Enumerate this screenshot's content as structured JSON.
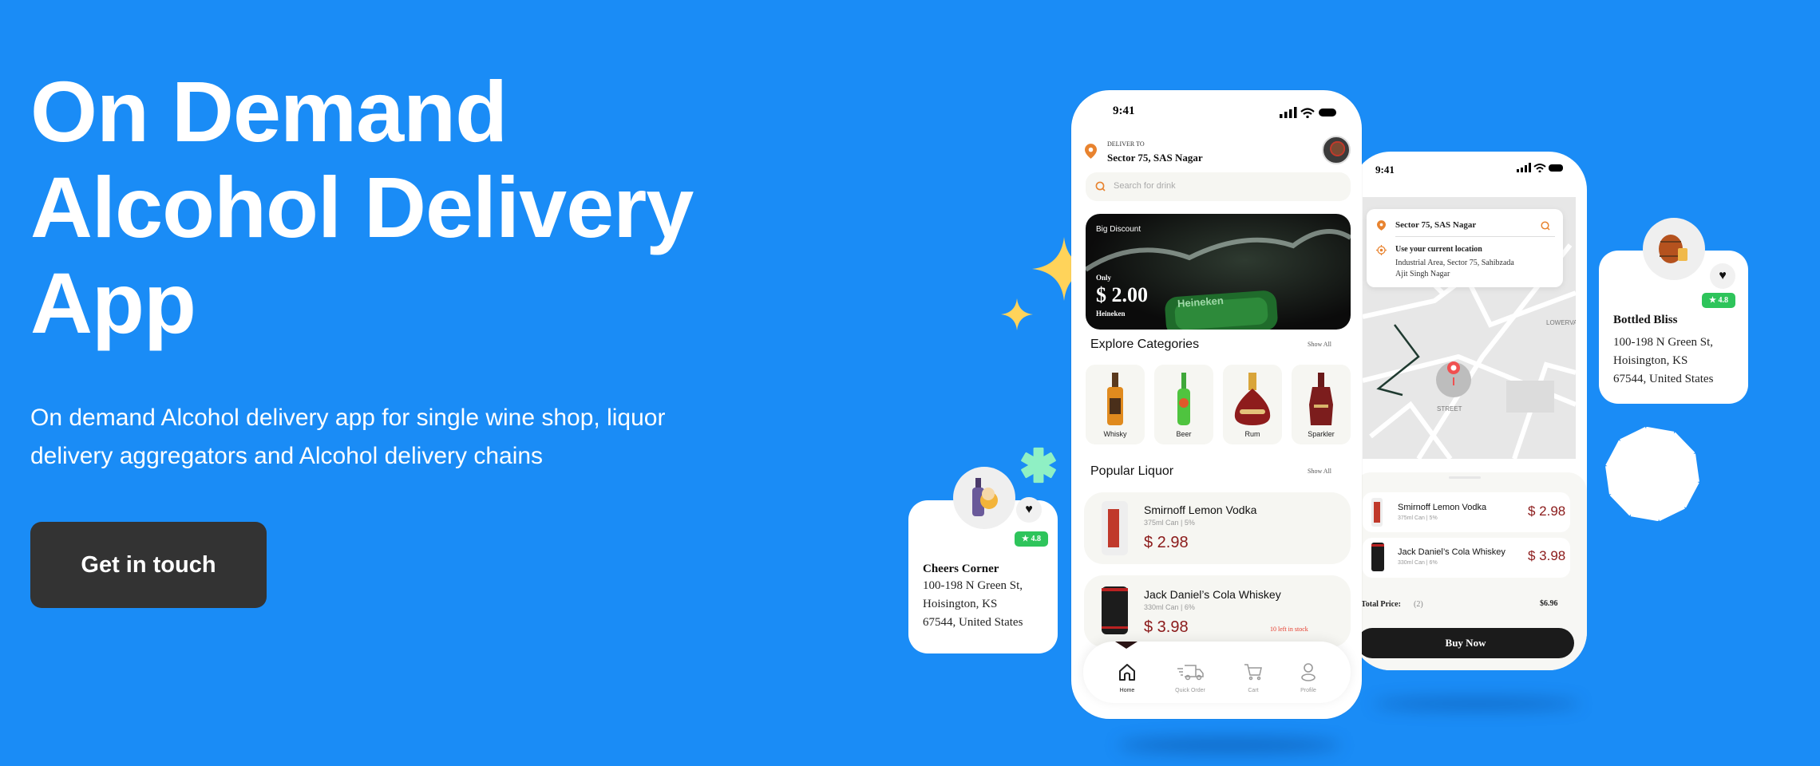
{
  "hero": {
    "title_lines": [
      "On Demand",
      "Alcohol Delivery",
      "App"
    ],
    "subtitle_lines": [
      "On demand Alcohol delivery app for single wine shop, liquor",
      "delivery aggregators and Alcohol delivery chains"
    ],
    "cta_label": "Get in touch"
  },
  "phone_home": {
    "time": "9:41",
    "deliver_label": "DELIVER TO",
    "address": "Sector 75, SAS Nagar",
    "search_placeholder": "Search for drink",
    "banner": {
      "tag": "Big Discount",
      "only": "Only",
      "price": "$ 2.00",
      "brand": "Heineken",
      "can_text": "Heineken"
    },
    "categories": {
      "title": "Explore Categories",
      "show_all": "Show All",
      "items": [
        {
          "label": "Whisky"
        },
        {
          "label": "Beer"
        },
        {
          "label": "Rum"
        },
        {
          "label": "Sparkler"
        }
      ]
    },
    "popular": {
      "title": "Popular Liquor",
      "show_all": "Show All",
      "items": [
        {
          "name": "Smirnoff Lemon Vodka",
          "detail": "375ml Can  |  5%",
          "price": "$ 2.98",
          "stock": ""
        },
        {
          "name": "Jack Daniel’s Cola Whiskey",
          "detail": "330ml Can  |  6%",
          "price": "$ 3.98",
          "stock": "10 left in stock"
        }
      ]
    },
    "nav": [
      {
        "label": "Home",
        "icon": "home-icon",
        "active": true
      },
      {
        "label": "Quick Order",
        "icon": "truck-icon"
      },
      {
        "label": "Cart",
        "icon": "cart-icon"
      },
      {
        "label": "Profile",
        "icon": "profile-icon"
      }
    ]
  },
  "phone_checkout": {
    "time": "9:41",
    "location": {
      "address": "Sector 75, SAS Nagar",
      "use_current": "Use your current location",
      "current_line1": "Industrial Area, Sector 75, Sahibzada",
      "current_line2": "Ajit Singh Nagar"
    },
    "map_labels": {
      "street": "STREET",
      "area": "LOWERVAL"
    },
    "items": [
      {
        "name": "Smirnoff Lemon Vodka",
        "detail": "375ml Can  |  5%",
        "price": "$ 2.98"
      },
      {
        "name": "Jack Daniel’s Cola Whiskey",
        "detail": "330ml Can  |  6%",
        "price": "$ 3.98"
      }
    ],
    "total_label": "Total Price:",
    "total_count": "(2)",
    "total_value": "$6.96",
    "buy_label": "Buy Now"
  },
  "stores": [
    {
      "name": "Cheers Corner",
      "rating": "★ 4.8",
      "address_lines": [
        "100-198 N Green St,",
        "Hoisington, KS",
        "67544, United States"
      ]
    },
    {
      "name": "Bottled Bliss",
      "rating": "★ 4.8",
      "address_lines": [
        "100-198 N Green St,",
        "Hoisington, KS",
        "67544, United States"
      ]
    }
  ],
  "colors": {
    "background": "#1a8cf6",
    "cta": "#333333",
    "price": "#8b1a1a",
    "accent_orange": "#e8832f",
    "rating": "#2ec45b",
    "sparkle": "#ffd35a"
  }
}
